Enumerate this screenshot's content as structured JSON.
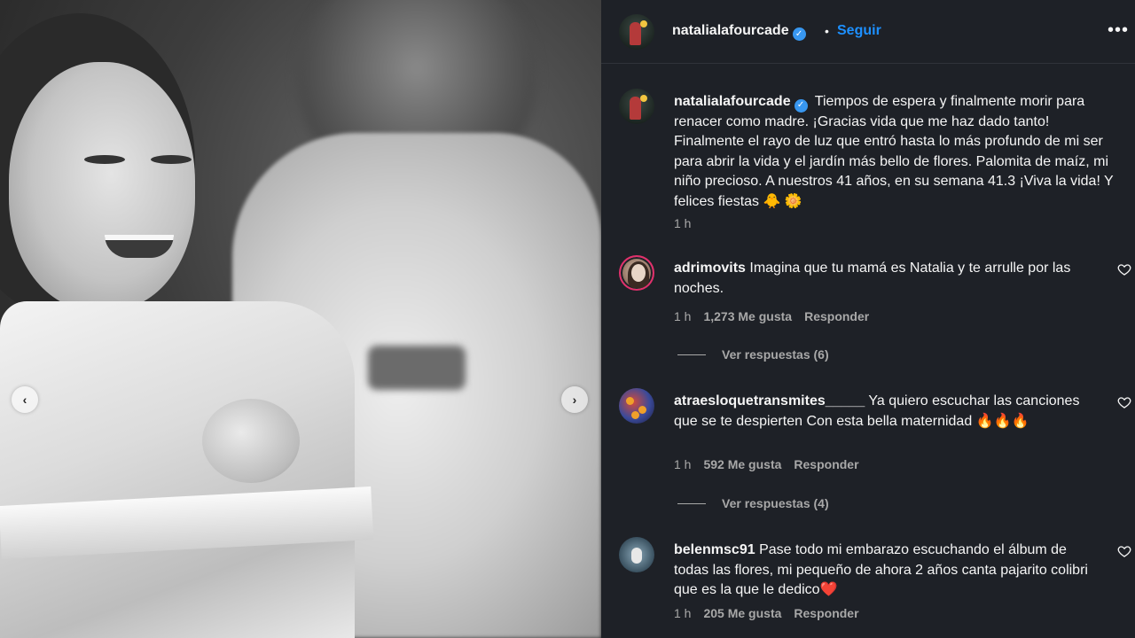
{
  "post": {
    "username": "natalialafourcade",
    "follow_label": "Seguir",
    "more_label": "•••",
    "caption": "Tiempos de espera y finalmente morir para renacer como madre. ¡Gracias vida que me haz dado tanto! Finalmente el rayo de luz que entró hasta lo más profundo de mi ser para abrir la vida y el jardín más bello de flores. Palomita de maíz, mi niño precioso. A nuestros 41 años, en su semana 41.3 ¡Viva la vida! Y felices fiestas 🐥 🌼",
    "caption_time": "1 h"
  },
  "carousel": {
    "prev_label": "‹",
    "next_label": "›"
  },
  "comments": [
    {
      "username": "adrimovits",
      "text": "Imagina que tu mamá es Natalia y te arrulle por las noches.",
      "time": "1 h",
      "likes": "1,273 Me gusta",
      "reply": "Responder",
      "view_replies": "Ver respuestas (6)"
    },
    {
      "username": "atraesloquetransmites_____",
      "text": "Ya quiero escuchar las canciones que se te despierten Con esta bella maternidad 🔥🔥🔥",
      "time": "1 h",
      "likes": "592 Me gusta",
      "reply": "Responder",
      "view_replies": "Ver respuestas (4)"
    },
    {
      "username": "belenmsc91",
      "text": "Pase todo mi embarazo escuchando el álbum de todas las flores, mi pequeño de ahora 2 años canta pajarito colibri que es la que le dedico❤️",
      "time": "1 h",
      "likes": "205 Me gusta",
      "reply": "Responder"
    }
  ],
  "colors": {
    "panel_bg": "#1e2127",
    "link_blue": "#1d90ff",
    "verified_blue": "#3897f0",
    "muted_text": "#a8a8a8"
  },
  "icons": {
    "verified": "verified-badge-icon",
    "heart": "heart-outline-icon",
    "more": "more-options-icon",
    "prev": "chevron-left-icon",
    "next": "chevron-right-icon"
  }
}
